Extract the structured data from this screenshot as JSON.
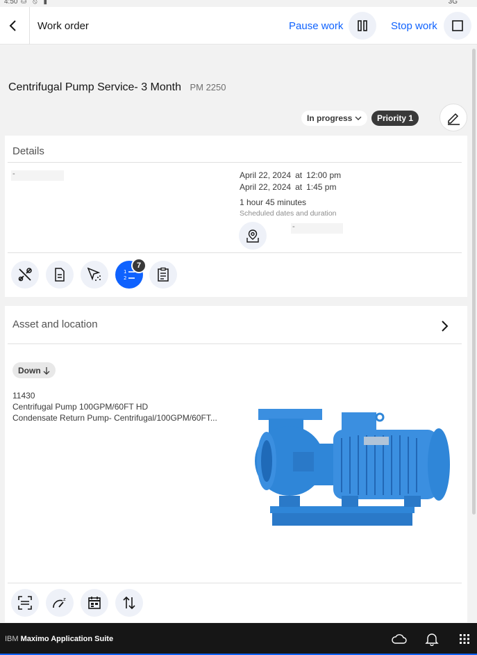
{
  "statusbar": {
    "time": "4:50",
    "icons": "⛀ ⦸ ▮",
    "network": "3G"
  },
  "appbar": {
    "title": "Work order",
    "pause_label": "Pause work",
    "stop_label": "Stop work"
  },
  "work_order": {
    "title": "Centrifugal Pump Service- 3 Month",
    "pm": "PM 2250",
    "status": "In progress",
    "priority": "Priority 1"
  },
  "details": {
    "heading": "Details",
    "left_placeholder": "-",
    "start": {
      "date": "April 22, 2024",
      "at": "at",
      "time": "12:00 pm"
    },
    "end": {
      "date": "April 22, 2024",
      "at": "at",
      "time": "1:45 pm"
    },
    "duration": "1 hour 45 minutes",
    "caption": "Scheduled dates and duration",
    "location_placeholder": "-",
    "task_badge": "7",
    "action_icons": [
      "tools-icon",
      "document-icon",
      "select-icon",
      "task-list-icon",
      "clipboard-icon"
    ]
  },
  "asset": {
    "heading": "Asset and location",
    "status": "Down",
    "number": "11430",
    "description": "Centrifugal Pump 100GPM/60FT HD",
    "location": "Condensate Return Pump- Centrifugal/100GPM/60FT...",
    "action_icons": [
      "scan-icon",
      "meter-icon",
      "calendar-icon",
      "sort-icon"
    ]
  },
  "footer": {
    "brand_prefix": "IBM",
    "brand_name": "Maximo Application Suite"
  },
  "colors": {
    "accent": "#0f62fe",
    "dark": "#393939",
    "footer": "#161616",
    "pump": "#2f86d8"
  }
}
